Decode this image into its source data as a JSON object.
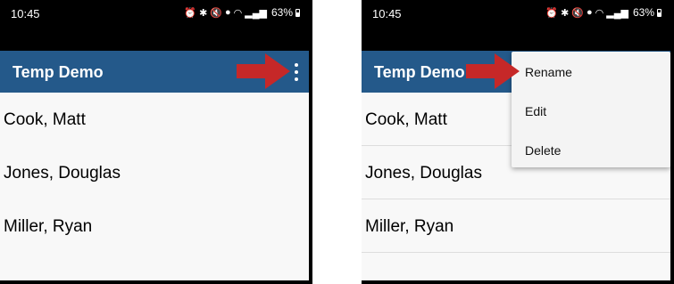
{
  "status_bar": {
    "time": "10:45",
    "battery": "63%",
    "icons": [
      "alarm-icon",
      "bluetooth-icon",
      "mute-icon",
      "location-icon",
      "wifi-icon",
      "signal-icon",
      "battery-icon"
    ]
  },
  "app_bar": {
    "title": "Temp Demo",
    "overflow_icon": "more-vert-icon"
  },
  "list": {
    "items": [
      "Cook, Matt",
      "Jones, Douglas",
      "Miller, Ryan"
    ]
  },
  "overflow_menu": {
    "items": [
      "Rename",
      "Edit",
      "Delete"
    ]
  },
  "colors": {
    "app_bar": "#24598a",
    "arrow": "#c62828",
    "frame": "#000000",
    "list_background": "#f8f8f8"
  }
}
